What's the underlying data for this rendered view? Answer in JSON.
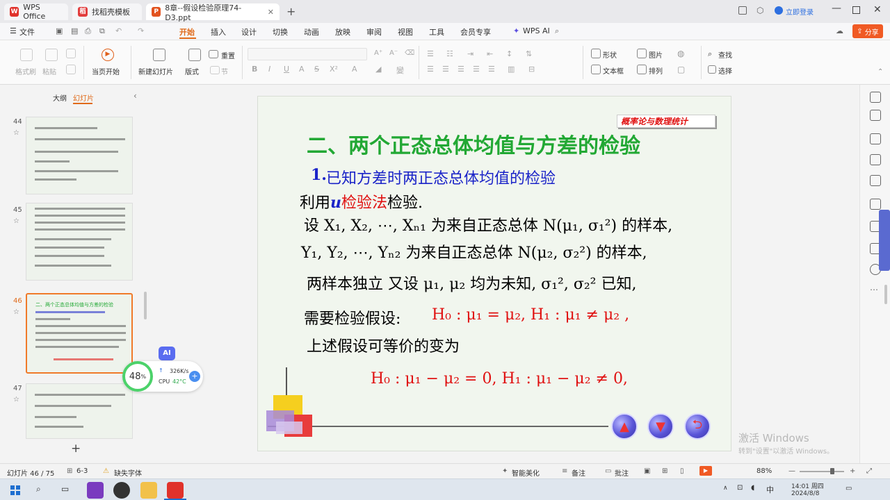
{
  "tabs": [
    {
      "label": "WPS Office"
    },
    {
      "label": "找稻壳模板"
    },
    {
      "label": "8章--假设检验原理74-D3.ppt"
    }
  ],
  "titlebar": {
    "login": "立即登录"
  },
  "menu": {
    "file": "文件",
    "items": [
      "开始",
      "插入",
      "设计",
      "切换",
      "动画",
      "放映",
      "审阅",
      "视图",
      "工具",
      "会员专享"
    ],
    "ai": "WPS AI",
    "share": "分享"
  },
  "ribbon": {
    "format_painter": "格式刷",
    "paste": "粘贴",
    "from_current": "当页开始",
    "new_slide": "新建幻灯片",
    "layout": "版式",
    "section": "节",
    "reset": "重置",
    "shape": "形状",
    "picture": "图片",
    "textbox": "文本框",
    "arrange": "排列",
    "find": "查找",
    "select": "选择"
  },
  "leftpane": {
    "tab_outline": "大纲",
    "tab_slides": "幻灯片",
    "add": "+",
    "thumbs": [
      {
        "num": "44"
      },
      {
        "num": "45"
      },
      {
        "num": "46",
        "title": "二、两个正态总体均值与方差的检验"
      },
      {
        "num": "47"
      }
    ]
  },
  "widget": {
    "percent": "48",
    "percent_unit": "%",
    "net": "326K/s",
    "cpu_label": "CPU",
    "cpu_val": "42°C",
    "ai": "AI"
  },
  "slide": {
    "banner": "概率论与数理统计",
    "title": "二、两个正态总体均值与方差的检验",
    "subtitle_num": "1.",
    "subtitle": "已知方差时两正态总体均值的检验",
    "l1a": "利用",
    "l1u": "u",
    "l1b": "检验法",
    "l1c": "检验.",
    "l2": "设 X₁, X₂, ⋯, Xₙ₁ 为来自正态总体 N(μ₁, σ₁²) 的样本,",
    "l3": "Y₁, Y₂, ⋯, Yₙ₂ 为来自正态总体 N(μ₂, σ₂²) 的样本,",
    "l4": "两样本独立   又设  μ₁, μ₂ 均为未知,  σ₁², σ₂² 已知,",
    "l5a": "需要检验假设:",
    "l5b": "H₀ : μ₁ = μ₂,   H₁ : μ₁ ≠ μ₂ ,",
    "l6": "上述假设可等价的变为",
    "l7": "H₀ : μ₁ − μ₂ = 0,   H₁ : μ₁ − μ₂ ≠ 0,"
  },
  "watermark": {
    "line1": "激活 Windows",
    "line2": "转到\"设置\"以激活 Windows。"
  },
  "status": {
    "slide_count": "幻灯片 46 / 75",
    "theme": "6-3",
    "missing_font": "缺失字体",
    "beautify": "智能美化",
    "notes": "备注",
    "comment": "批注",
    "zoom": "88%"
  },
  "taskbar": {
    "time": "14:01 周四",
    "date": "2024/8/8",
    "ime": "中"
  },
  "colors": {
    "accent": "#f07a2a",
    "title_green": "#22a834",
    "subtitle_blue": "#1a23c8",
    "formula_red": "#e01010"
  }
}
